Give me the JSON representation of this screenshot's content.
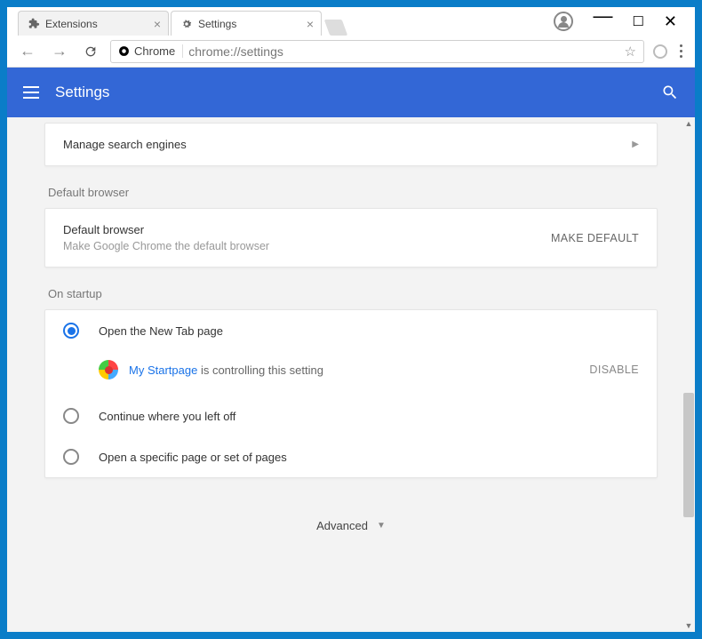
{
  "tabs": {
    "items": [
      {
        "title": "Extensions"
      },
      {
        "title": "Settings"
      }
    ]
  },
  "address": {
    "origin_label": "Chrome",
    "url": "chrome://settings"
  },
  "header": {
    "title": "Settings"
  },
  "search_engines": {
    "label": "Manage search engines"
  },
  "default_browser": {
    "section_label": "Default browser",
    "title": "Default browser",
    "subtitle": "Make Google Chrome the default browser",
    "button": "MAKE DEFAULT"
  },
  "startup": {
    "section_label": "On startup",
    "options": [
      "Open the New Tab page",
      "Continue where you left off",
      "Open a specific page or set of pages"
    ],
    "controlled": {
      "extension_name": "My Startpage",
      "suffix": " is controlling this setting",
      "disable": "DISABLE"
    }
  },
  "footer": {
    "advanced": "Advanced"
  }
}
